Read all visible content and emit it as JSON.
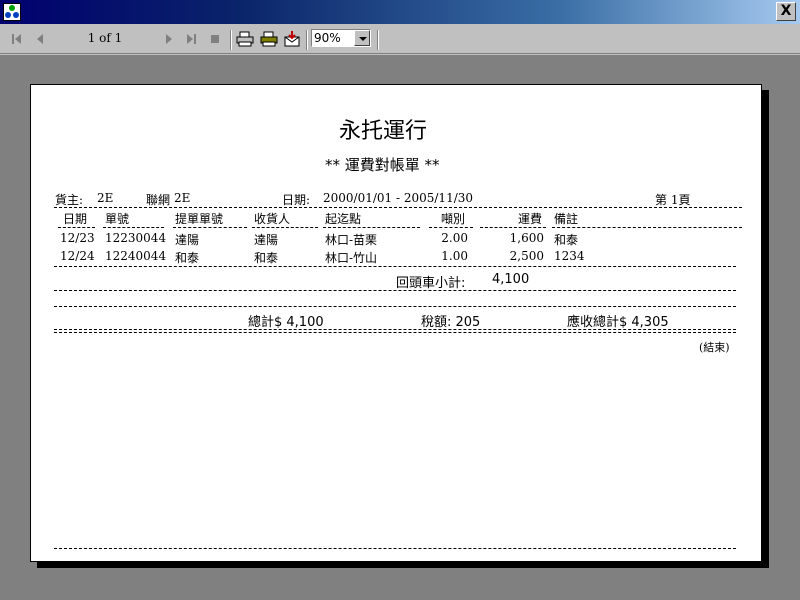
{
  "window": {
    "close_glyph": "X"
  },
  "toolbar": {
    "page_counter": "1 of 1",
    "zoom": "90%",
    "icons": [
      "first-page-icon",
      "previous-page-icon",
      "next-page-icon",
      "last-page-icon",
      "stop-icon",
      "print-icon",
      "printer-setup-icon",
      "export-icon"
    ]
  },
  "report": {
    "company": "永托運行",
    "title": "** 運費對帳單 **",
    "header": {
      "consignor_label": "貨主:",
      "consignor_value": "2E",
      "network_label": "聯網",
      "network_value": "2E",
      "date_label": "日期:",
      "date_range": "2000/01/01 - 2005/11/30",
      "page_label": "第 1頁"
    },
    "columns": [
      "日期",
      "單號",
      "提單單號",
      "收貨人",
      "起迄點",
      "噸別",
      "運費",
      "備註"
    ],
    "rows": [
      [
        "12/23",
        "12230044",
        "達陽",
        "達陽",
        "林口-苗栗",
        "2.00",
        "1,600",
        "和泰"
      ],
      [
        "12/24",
        "12240044",
        "和泰",
        "和泰",
        "林口-竹山",
        "1.00",
        "2,500",
        "1234"
      ]
    ],
    "subtotal_label": "回頭車小計:",
    "subtotal_value": "4,100",
    "total": "總計$ 4,100",
    "tax": "稅額: 205",
    "receivable": "應收總計$ 4,305",
    "end_note": "(結束)"
  }
}
